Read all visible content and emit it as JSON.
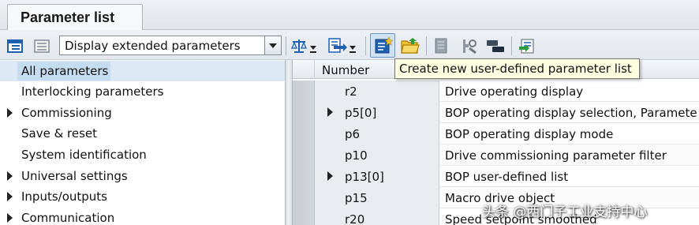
{
  "tab": {
    "label": "Parameter list"
  },
  "toolbar": {
    "view_select_value": "Display extended parameters",
    "icons": [
      "tree-view-icon",
      "flat-view-icon",
      "compare-icon",
      "transfer-icon",
      "create-user-list-icon",
      "open-folder-icon",
      "save-icon",
      "tools-icon",
      "swap-icon",
      "export-icon"
    ]
  },
  "tooltip": {
    "text": "Create new user-defined parameter list"
  },
  "tree": {
    "items": [
      {
        "label": "All parameters",
        "expandable": false,
        "selected": true
      },
      {
        "label": "Interlocking parameters",
        "expandable": false
      },
      {
        "label": "Commissioning",
        "expandable": true
      },
      {
        "label": "Save & reset",
        "expandable": false
      },
      {
        "label": "System identification",
        "expandable": false
      },
      {
        "label": "Universal settings",
        "expandable": true
      },
      {
        "label": "Inputs/outputs",
        "expandable": true
      },
      {
        "label": "Communication",
        "expandable": true
      }
    ]
  },
  "table": {
    "header_number": "Number",
    "rows": [
      {
        "number": "r2",
        "expandable": false,
        "description": "Drive operating display"
      },
      {
        "number": "p5[0]",
        "expandable": true,
        "description": "BOP operating display selection, Paramete"
      },
      {
        "number": "p6",
        "expandable": false,
        "description": "BOP operating display mode"
      },
      {
        "number": "p10",
        "expandable": false,
        "description": "Drive commissioning parameter filter"
      },
      {
        "number": "p13[0]",
        "expandable": true,
        "description": "BOP user-defined list"
      },
      {
        "number": "p15",
        "expandable": false,
        "description": "Macro drive object"
      },
      {
        "number": "r20",
        "expandable": false,
        "description": "Speed setpoint smoothed"
      }
    ]
  },
  "watermark": {
    "text": "头条 @西门子工业支持中心"
  },
  "colors": {
    "selection": "#c4dbf0",
    "tooltip_bg": "#ffffe1",
    "icon_blue": "#1f5fb0",
    "icon_yellow": "#f1c232"
  }
}
